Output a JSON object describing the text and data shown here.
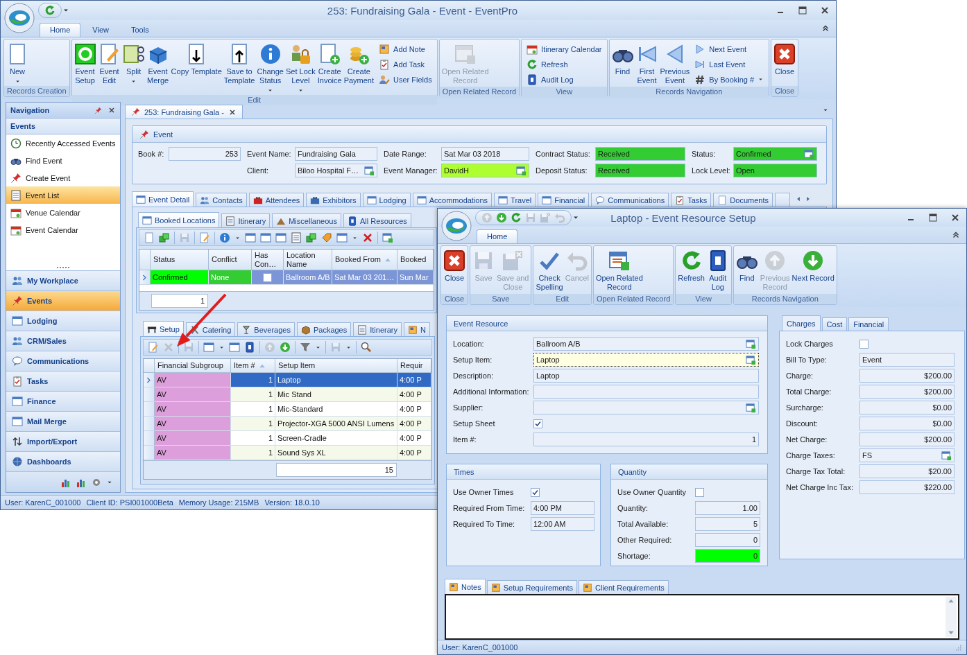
{
  "main_window": {
    "title": "253: Fundraising Gala - Event - EventPro",
    "ribbon_tabs": [
      {
        "label": "Home",
        "selected": true
      },
      {
        "label": "View",
        "selected": false
      },
      {
        "label": "Tools",
        "selected": false
      }
    ],
    "ribbon_groups": [
      {
        "caption": "Records Creation",
        "buttons": [
          {
            "kind": "large",
            "label": "New",
            "dropdown": true,
            "disabled": false
          }
        ]
      },
      {
        "caption": "Edit",
        "buttons": [
          {
            "kind": "large",
            "label": "Event\nSetup",
            "dropdown": false,
            "disabled": false
          },
          {
            "kind": "large",
            "label": "Event\nEdit",
            "dropdown": false,
            "disabled": false
          },
          {
            "kind": "large",
            "label": "Split",
            "dropdown": true,
            "disabled": false
          },
          {
            "kind": "large",
            "label": "Event\nMerge",
            "dropdown": false,
            "disabled": false
          },
          {
            "kind": "large",
            "label": "Copy Template",
            "dropdown": false,
            "disabled": false
          },
          {
            "kind": "large",
            "label": "Save to\nTemplate",
            "dropdown": false,
            "disabled": false
          },
          {
            "kind": "large",
            "label": "Change\nStatus",
            "dropdown": true,
            "disabled": false
          },
          {
            "kind": "large",
            "label": "Set Lock\nLevel",
            "dropdown": true,
            "disabled": false
          },
          {
            "kind": "large",
            "label": "Create\nInvoice",
            "dropdown": false,
            "disabled": false
          },
          {
            "kind": "large",
            "label": "Create\nPayment",
            "dropdown": false,
            "disabled": false
          },
          {
            "kind": "small",
            "label": "Add Note",
            "dropdown": false,
            "disabled": false
          },
          {
            "kind": "small",
            "label": "Add Task",
            "dropdown": false,
            "disabled": false
          },
          {
            "kind": "small",
            "label": "User Fields",
            "dropdown": false,
            "disabled": false
          }
        ]
      },
      {
        "caption": "Open Related Record",
        "buttons": [
          {
            "kind": "large",
            "label": "Open Related\nRecord",
            "dropdown": false,
            "disabled": true
          }
        ]
      },
      {
        "caption": "View",
        "buttons": [
          {
            "kind": "small",
            "label": "Itinerary Calendar",
            "dropdown": false,
            "disabled": false
          },
          {
            "kind": "small",
            "label": "Refresh",
            "dropdown": false,
            "disabled": false
          },
          {
            "kind": "small",
            "label": "Audit Log",
            "dropdown": false,
            "disabled": false
          }
        ]
      },
      {
        "caption": "Records Navigation",
        "buttons": [
          {
            "kind": "large",
            "label": "Find",
            "dropdown": false,
            "disabled": false
          },
          {
            "kind": "large",
            "label": "First\nEvent",
            "dropdown": false,
            "disabled": false
          },
          {
            "kind": "large",
            "label": "Previous\nEvent",
            "dropdown": false,
            "disabled": false
          },
          {
            "kind": "small",
            "label": "Next Event",
            "dropdown": false,
            "disabled": false
          },
          {
            "kind": "small",
            "label": "Last Event",
            "dropdown": false,
            "disabled": false
          },
          {
            "kind": "small",
            "label": "By Booking #",
            "dropdown": true,
            "disabled": false
          }
        ]
      },
      {
        "caption": "Close",
        "buttons": [
          {
            "kind": "large",
            "label": "Close",
            "dropdown": false,
            "disabled": false
          }
        ]
      }
    ],
    "navigation": {
      "title": "Navigation",
      "group": "Events",
      "items": [
        {
          "label": "Recently Accessed Events",
          "selected": false
        },
        {
          "label": "Find Event",
          "selected": false
        },
        {
          "label": "Create Event",
          "selected": false
        },
        {
          "label": "Event List",
          "selected": true
        },
        {
          "label": "Venue Calendar",
          "selected": false
        },
        {
          "label": "Event Calendar",
          "selected": false
        }
      ],
      "buttons": [
        {
          "label": "My Workplace",
          "selected": false
        },
        {
          "label": "Events",
          "selected": true
        },
        {
          "label": "Lodging",
          "selected": false
        },
        {
          "label": "CRM/Sales",
          "selected": false
        },
        {
          "label": "Communications",
          "selected": false
        },
        {
          "label": "Tasks",
          "selected": false
        },
        {
          "label": "Finance",
          "selected": false
        },
        {
          "label": "Mail Merge",
          "selected": false
        },
        {
          "label": "Import/Export",
          "selected": false
        },
        {
          "label": "Dashboards",
          "selected": false
        }
      ]
    },
    "document_tab": {
      "label": "253: Fundraising Gala -"
    },
    "event": {
      "title": "Event",
      "columns": [
        [
          {
            "label": "Book #:",
            "value": "253",
            "kind": "number",
            "lookup": false
          }
        ],
        [
          {
            "label": "Event Name:",
            "value": "Fundraising Gala",
            "kind": "text",
            "lookup": false
          },
          {
            "label": "Client:",
            "value": "Biloo Hospital F…",
            "kind": "text",
            "lookup": true
          }
        ],
        [
          {
            "label": "Date Range:",
            "value": "Sat Mar 03 2018",
            "kind": "text",
            "lookup": false
          },
          {
            "label": "Event Manager:",
            "value": "DavidH",
            "kind": "text",
            "lookup": true,
            "color": "#adff2f"
          }
        ],
        [
          {
            "label": "Contract Status:",
            "value": "Received",
            "kind": "text",
            "lookup": false,
            "color": "#33cc33"
          },
          {
            "label": "Deposit Status:",
            "value": "Received",
            "kind": "text",
            "lookup": false,
            "color": "#33cc33"
          }
        ],
        [
          {
            "label": "Status:",
            "value": "Confirmed",
            "kind": "text",
            "lookup": true,
            "color": "#33cc33"
          },
          {
            "label": "Lock Level:",
            "value": "Open",
            "kind": "text",
            "lookup": false,
            "color": "#33cc33"
          }
        ]
      ]
    },
    "event_tabs": [
      {
        "label": "Event Detail",
        "selected": true
      },
      {
        "label": "Contacts",
        "selected": false
      },
      {
        "label": "Attendees",
        "selected": false
      },
      {
        "label": "Exhibitors",
        "selected": false
      },
      {
        "label": "Lodging",
        "selected": false
      },
      {
        "label": "Accommodations",
        "selected": false
      },
      {
        "label": "Travel",
        "selected": false
      },
      {
        "label": "Financial",
        "selected": false
      },
      {
        "label": "Communications",
        "selected": false
      },
      {
        "label": "Tasks",
        "selected": false
      },
      {
        "label": "Documents",
        "selected": false
      }
    ],
    "location_tabs": [
      {
        "label": "Booked Locations",
        "selected": true
      },
      {
        "label": "Itinerary",
        "selected": false
      },
      {
        "label": "Miscellaneous",
        "selected": false
      },
      {
        "label": "All Resources",
        "selected": false
      }
    ],
    "locations_grid": {
      "columns": [
        {
          "label": "Status",
          "sorted": false
        },
        {
          "label": "Conflict",
          "sorted": false
        },
        {
          "label": "Has Con…",
          "sorted": false
        },
        {
          "label": "Location Name",
          "sorted": false
        },
        {
          "label": "Booked From",
          "sorted": true
        },
        {
          "label": "Booked",
          "sorted": false
        }
      ],
      "rows": [
        {
          "selected": true,
          "cells": [
            {
              "kind": "text",
              "text": "Confirmed",
              "color": "#00ff00"
            },
            {
              "kind": "text",
              "text": "None",
              "color": "#33cc33"
            },
            {
              "kind": "checkbox",
              "checked": false
            },
            {
              "kind": "text",
              "text": "Ballroom A/B"
            },
            {
              "kind": "text",
              "text": "Sat Mar 03 201…"
            },
            {
              "kind": "text",
              "text": "Sun Mar"
            }
          ]
        }
      ],
      "footer": "1"
    },
    "setup_tabs": [
      {
        "label": "Setup",
        "selected": true
      },
      {
        "label": "Catering",
        "selected": false
      },
      {
        "label": "Beverages",
        "selected": false
      },
      {
        "label": "Packages",
        "selected": false
      },
      {
        "label": "Itinerary",
        "selected": false
      },
      {
        "label": "N",
        "selected": false
      }
    ],
    "setup_grid": {
      "columns": [
        {
          "label": "Financial Subgroup",
          "sorted": false
        },
        {
          "label": "Item #",
          "sorted": true
        },
        {
          "label": "Setup Item",
          "sorted": false
        },
        {
          "label": "Requir",
          "sorted": false
        }
      ],
      "rows": [
        {
          "selected": true,
          "cells": [
            {
              "kind": "text",
              "text": "AV",
              "color": "#dd9fdb"
            },
            {
              "kind": "number",
              "text": "1"
            },
            {
              "kind": "text",
              "text": "Laptop"
            },
            {
              "kind": "text",
              "text": "4:00 P"
            }
          ]
        },
        {
          "selected": false,
          "cells": [
            {
              "kind": "text",
              "text": "AV",
              "color": "#dd9fdb"
            },
            {
              "kind": "number",
              "text": "1"
            },
            {
              "kind": "text",
              "text": "Mic Stand"
            },
            {
              "kind": "text",
              "text": "4:00 P"
            }
          ]
        },
        {
          "selected": false,
          "cells": [
            {
              "kind": "text",
              "text": "AV",
              "color": "#dd9fdb"
            },
            {
              "kind": "number",
              "text": "1"
            },
            {
              "kind": "text",
              "text": "Mic-Standard"
            },
            {
              "kind": "text",
              "text": "4:00 P"
            }
          ]
        },
        {
          "selected": false,
          "cells": [
            {
              "kind": "text",
              "text": "AV",
              "color": "#dd9fdb"
            },
            {
              "kind": "number",
              "text": "1"
            },
            {
              "kind": "text",
              "text": "Projector-XGA 5000 ANSI Lumens"
            },
            {
              "kind": "text",
              "text": "4:00 P"
            }
          ]
        },
        {
          "selected": false,
          "cells": [
            {
              "kind": "text",
              "text": "AV",
              "color": "#dd9fdb"
            },
            {
              "kind": "number",
              "text": "1"
            },
            {
              "kind": "text",
              "text": "Screen-Cradle"
            },
            {
              "kind": "text",
              "text": "4:00 P"
            }
          ]
        },
        {
          "selected": false,
          "cells": [
            {
              "kind": "text",
              "text": "AV",
              "color": "#dd9fdb"
            },
            {
              "kind": "number",
              "text": "1"
            },
            {
              "kind": "text",
              "text": "Sound Sys XL"
            },
            {
              "kind": "text",
              "text": "4:00 P"
            }
          ]
        }
      ],
      "footer": "15"
    },
    "status_bar": [
      "User: KarenC_001000",
      "Client ID: PSI001000Beta",
      "Memory Usage: 215MB",
      "Version: 18.0.10"
    ]
  },
  "resource_window": {
    "title": "Laptop - Event Resource Setup",
    "ribbon_tabs": [
      {
        "label": "Home",
        "selected": true
      }
    ],
    "ribbon_groups": [
      {
        "caption": "Close",
        "buttons": [
          {
            "label": "Close",
            "disabled": false
          }
        ]
      },
      {
        "caption": "Save",
        "buttons": [
          {
            "label": "Save",
            "disabled": true
          },
          {
            "label": "Save and\nClose",
            "disabled": true
          }
        ]
      },
      {
        "caption": "Edit",
        "buttons": [
          {
            "label": "Check\nSpelling",
            "disabled": false
          },
          {
            "label": "Cancel",
            "disabled": true
          }
        ]
      },
      {
        "caption": "Open Related Record",
        "buttons": [
          {
            "label": "Open Related\nRecord",
            "disabled": false
          }
        ]
      },
      {
        "caption": "View",
        "buttons": [
          {
            "label": "Refresh",
            "disabled": false
          },
          {
            "label": "Audit\nLog",
            "disabled": false
          }
        ]
      },
      {
        "caption": "Records Navigation",
        "buttons": [
          {
            "label": "Find",
            "disabled": false
          },
          {
            "label": "Previous\nRecord",
            "disabled": true
          },
          {
            "label": "Next Record",
            "disabled": false
          }
        ]
      }
    ],
    "event_resource": {
      "title": "Event Resource",
      "fields": [
        {
          "label": "Location:",
          "kind": "text",
          "value": "Ballroom A/B",
          "lookup": true,
          "focused": false
        },
        {
          "label": "Setup Item:",
          "kind": "text",
          "value": "Laptop",
          "lookup": true,
          "focused": true
        },
        {
          "label": "Description:",
          "kind": "text",
          "value": "Laptop",
          "lookup": false,
          "focused": false
        },
        {
          "label": "Additional Information:",
          "kind": "text",
          "lookup": false,
          "focused": false
        },
        {
          "label": "Supplier:",
          "kind": "text",
          "lookup": true,
          "focused": false
        },
        {
          "label": "Setup Sheet",
          "kind": "checkbox",
          "checked": true
        },
        {
          "label": "Item #:",
          "kind": "number",
          "value": "1",
          "lookup": false,
          "focused": false
        }
      ]
    },
    "times": {
      "title": "Times",
      "fields": [
        {
          "label": "Use Owner Times",
          "kind": "checkbox",
          "checked": true
        },
        {
          "label": "Required From Time:",
          "kind": "text",
          "value": "4:00 PM"
        },
        {
          "label": "Required To Time:",
          "kind": "text",
          "value": "12:00 AM"
        }
      ]
    },
    "quantity": {
      "title": "Quantity",
      "fields": [
        {
          "label": "Use Owner Quantity",
          "kind": "checkbox",
          "checked": false
        },
        {
          "label": "Quantity:",
          "kind": "number",
          "value": "1.00"
        },
        {
          "label": "Total Available:",
          "kind": "number",
          "value": "5"
        },
        {
          "label": "Other Required:",
          "kind": "number",
          "value": "0"
        },
        {
          "label": "Shortage:",
          "kind": "number",
          "value": "0",
          "color": "#00ff00"
        }
      ]
    },
    "charges_tabs": [
      {
        "label": "Charges",
        "selected": true
      },
      {
        "label": "Cost",
        "selected": false
      },
      {
        "label": "Financial",
        "selected": false
      }
    ],
    "charges": [
      {
        "label": "Lock Charges",
        "kind": "checkbox",
        "checked": false
      },
      {
        "label": "Bill To Type:",
        "kind": "text",
        "value": "Event",
        "lookup": false
      },
      {
        "label": "Charge:",
        "kind": "number",
        "value": "$200.00",
        "lookup": false
      },
      {
        "label": "Total Charge:",
        "kind": "number",
        "value": "$200.00",
        "lookup": false
      },
      {
        "label": "Surcharge:",
        "kind": "number",
        "value": "$0.00",
        "lookup": false
      },
      {
        "label": "Discount:",
        "kind": "number",
        "value": "$0.00",
        "lookup": false
      },
      {
        "label": "Net Charge:",
        "kind": "number",
        "value": "$200.00",
        "lookup": false
      },
      {
        "label": "Charge Taxes:",
        "kind": "text",
        "value": "FS",
        "lookup": true
      },
      {
        "label": "Charge Tax Total:",
        "kind": "number",
        "value": "$20.00",
        "lookup": false
      },
      {
        "label": "Net Charge Inc Tax:",
        "kind": "number",
        "value": "$220.00",
        "lookup": false
      }
    ],
    "notes_tabs": [
      {
        "label": "Notes",
        "selected": true
      },
      {
        "label": "Setup Requirements",
        "selected": false
      },
      {
        "label": "Client Requirements",
        "selected": false
      }
    ],
    "status_bar": [
      "User: KarenC_001000"
    ]
  }
}
